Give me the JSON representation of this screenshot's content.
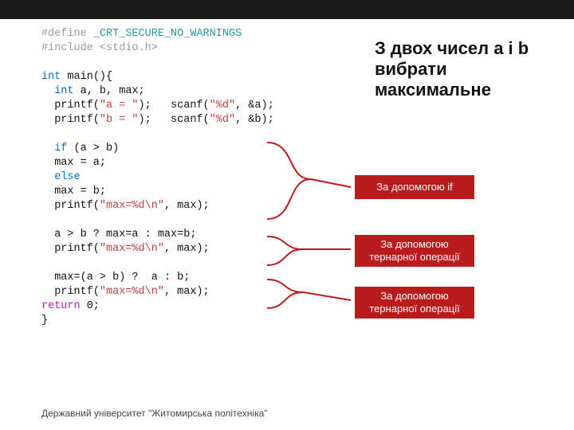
{
  "title": "З двох чисел a і b вибрати максимальне",
  "annotations": {
    "a1": "За допомогою if",
    "a2": "За допомогою тернарної операції",
    "a3": "За допомогою тернарної операції"
  },
  "footer": "Державний університет \"Житомирська політехніка\"",
  "code": {
    "l1a": "#define",
    "l1b": " _CRT_SECURE_NO_WARNINGS",
    "l2a": "#include",
    "l2b": " <stdio.h>",
    "l4a": "int",
    "l4b": " main(){",
    "l5a": "  ",
    "l5b": "int",
    "l5c": " a, b, max;",
    "l6a": "  printf(",
    "l6b": "\"a = \"",
    "l6c": ");   scanf(",
    "l6d": "\"%d\"",
    "l6e": ", &a);",
    "l7a": "  printf(",
    "l7b": "\"b = \"",
    "l7c": ");   scanf(",
    "l7d": "\"%d\"",
    "l7e": ", &b);",
    "l9a": "  ",
    "l9b": "if",
    "l9c": " (a > b)",
    "l10": "  max = a;",
    "l11a": "  ",
    "l11b": "else",
    "l12": "  max = b;",
    "l13a": "  printf(",
    "l13b": "\"max=%d\\n\"",
    "l13c": ", max);",
    "l15": "  a > b ? max=a : max=b;",
    "l16a": "  printf(",
    "l16b": "\"max=%d\\n\"",
    "l16c": ", max);",
    "l18": "  max=(a > b) ?  a : b;",
    "l19a": "  printf(",
    "l19b": "\"max=%d\\n\"",
    "l19c": ", max);",
    "l20a": "return",
    "l20b": " 0;",
    "l21": "}"
  }
}
